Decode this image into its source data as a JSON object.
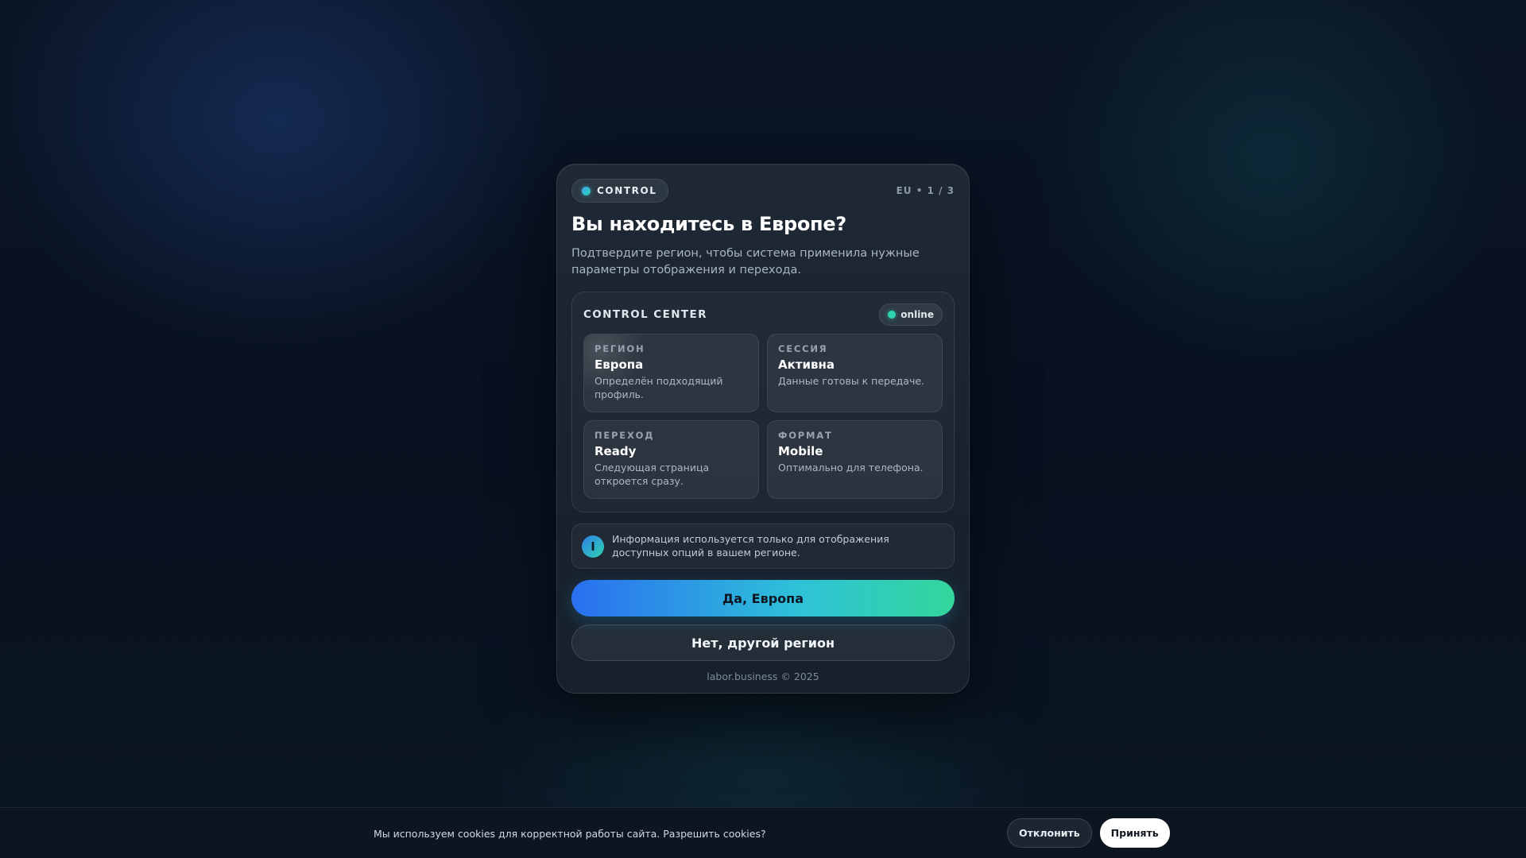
{
  "modal": {
    "badge": "CONTROL",
    "step": "EU • 1 / 3",
    "title": "Вы находитесь в Европе?",
    "subtitle": "Подтвердите регион, чтобы система применила нужные параметры отображения и перехода.",
    "panel": {
      "title": "CONTROL CENTER",
      "status": "online",
      "tiles": [
        {
          "label": "РЕГИОН",
          "value": "Европа",
          "desc": "Определён подходящий профиль."
        },
        {
          "label": "СЕССИЯ",
          "value": "Активна",
          "desc": "Данные готовы к передаче."
        },
        {
          "label": "ПЕРЕХОД",
          "value": "Ready",
          "desc": "Следующая страница откроется сразу."
        },
        {
          "label": "ФОРМАТ",
          "value": "Mobile",
          "desc": "Оптимально для телефона."
        }
      ]
    },
    "info": {
      "icon": "I",
      "text": "Информация используется только для отображения доступных опций в вашем регионе."
    },
    "primary_button": "Да, Европа",
    "secondary_button": "Нет, другой регион",
    "footer": "labor.business © 2025"
  },
  "cookie": {
    "text": "Мы используем cookies для корректной работы сайта. Разрешить cookies?",
    "decline": "Отклонить",
    "accept": "Принять"
  },
  "colors": {
    "accent_start": "#2a6ff0",
    "accent_end": "#33d69a",
    "online": "#2ed3b0"
  }
}
